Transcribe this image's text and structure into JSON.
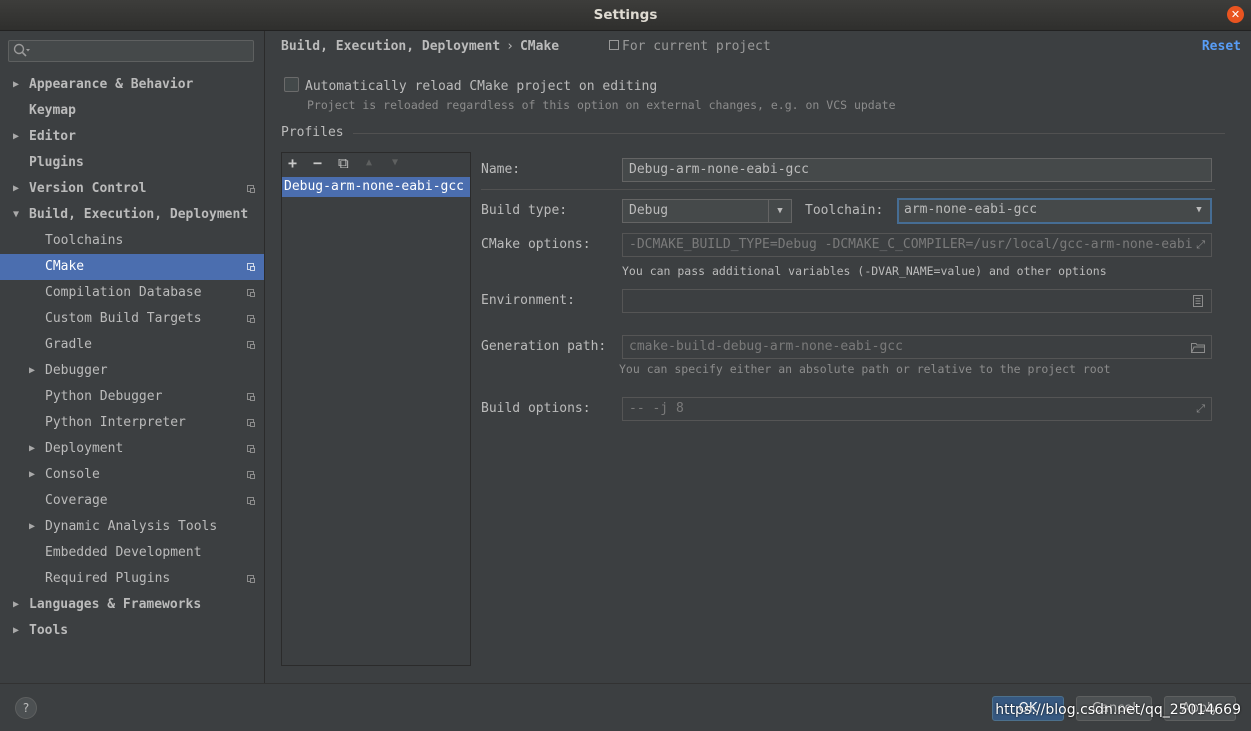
{
  "window": {
    "title": "Settings",
    "close_glyph": "✕"
  },
  "search": {
    "placeholder": "",
    "icon": "search-icon"
  },
  "tree": [
    {
      "label": "Appearance & Behavior",
      "level": 0,
      "arrow": "▶",
      "bold": true
    },
    {
      "label": "Keymap",
      "level": 0,
      "arrow": "",
      "bold": true
    },
    {
      "label": "Editor",
      "level": 0,
      "arrow": "▶",
      "bold": true
    },
    {
      "label": "Plugins",
      "level": 0,
      "arrow": "",
      "bold": true
    },
    {
      "label": "Version Control",
      "level": 0,
      "arrow": "▶",
      "bold": true,
      "project": true
    },
    {
      "label": "Build, Execution, Deployment",
      "level": 0,
      "arrow": "▼",
      "bold": true
    },
    {
      "label": "Toolchains",
      "level": 1,
      "arrow": ""
    },
    {
      "label": "CMake",
      "level": 1,
      "arrow": "",
      "project": true,
      "selected": true
    },
    {
      "label": "Compilation Database",
      "level": 1,
      "arrow": "",
      "project": true
    },
    {
      "label": "Custom Build Targets",
      "level": 1,
      "arrow": "",
      "project": true
    },
    {
      "label": "Gradle",
      "level": 1,
      "arrow": "",
      "project": true
    },
    {
      "label": "Debugger",
      "level": 1,
      "arrow": "▶"
    },
    {
      "label": "Python Debugger",
      "level": 1,
      "arrow": "",
      "project": true
    },
    {
      "label": "Python Interpreter",
      "level": 1,
      "arrow": "",
      "project": true
    },
    {
      "label": "Deployment",
      "level": 1,
      "arrow": "▶",
      "project": true
    },
    {
      "label": "Console",
      "level": 1,
      "arrow": "▶",
      "project": true
    },
    {
      "label": "Coverage",
      "level": 1,
      "arrow": "",
      "project": true
    },
    {
      "label": "Dynamic Analysis Tools",
      "level": 1,
      "arrow": "▶"
    },
    {
      "label": "Embedded Development",
      "level": 1,
      "arrow": ""
    },
    {
      "label": "Required Plugins",
      "level": 1,
      "arrow": "",
      "project": true
    },
    {
      "label": "Languages & Frameworks",
      "level": 0,
      "arrow": "▶",
      "bold": true
    },
    {
      "label": "Tools",
      "level": 0,
      "arrow": "▶",
      "bold": true
    }
  ],
  "header": {
    "breadcrumb_parent": "Build, Execution, Deployment",
    "breadcrumb_sep": "›",
    "breadcrumb_current": "CMake",
    "scope": "For current project",
    "reset": "Reset"
  },
  "auto_reload": {
    "label": "Automatically reload CMake project on editing",
    "checked": false,
    "hint": "Project is reloaded regardless of this option on external changes, e.g. on VCS update"
  },
  "profiles": {
    "title": "Profiles",
    "toolbar": {
      "add": "+",
      "remove": "−",
      "copy": "⧉",
      "up": "▲",
      "down": "▼"
    },
    "items": [
      "Debug-arm-none-eabi-gcc"
    ]
  },
  "form": {
    "name_label": "Name:",
    "name_value": "Debug-arm-none-eabi-gcc",
    "build_type_label": "Build type:",
    "build_type_value": "Debug",
    "toolchain_label": "Toolchain:",
    "toolchain_value": "arm-none-eabi-gcc",
    "cmake_options_label": "CMake options:",
    "cmake_options_value": "-DCMAKE_BUILD_TYPE=Debug -DCMAKE_C_COMPILER=/usr/local/gcc-arm-none-eabi",
    "cmake_options_hint": "You can pass additional variables (-DVAR_NAME=value) and other options",
    "environment_label": "Environment:",
    "environment_value": "",
    "generation_path_label": "Generation path:",
    "generation_path_value": "cmake-build-debug-arm-none-eabi-gcc",
    "generation_path_hint": "You can specify either an absolute path or relative to the project root",
    "build_options_label": "Build options:",
    "build_options_value": "-- -j 8"
  },
  "footer": {
    "help": "?",
    "ok": "OK",
    "cancel": "Cancel",
    "apply": "Apply",
    "watermark": "https://blog.csdn.net/qq_25014669"
  },
  "colors": {
    "accent": "#4b6eaf",
    "link": "#589df6",
    "background": "#3c3f41"
  }
}
